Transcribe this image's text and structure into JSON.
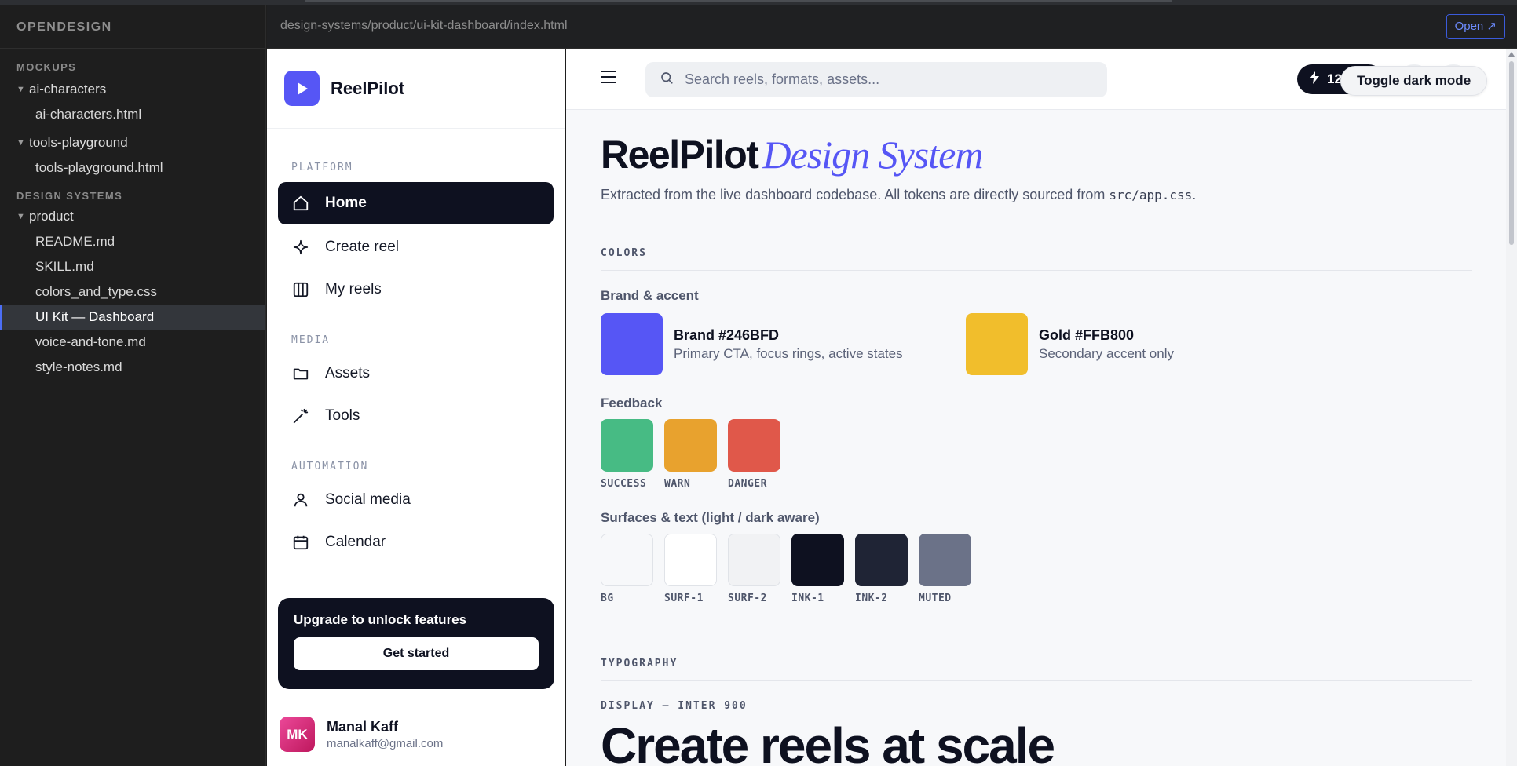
{
  "file_tree": {
    "brand": "OPENDESIGN",
    "sections": [
      {
        "title": "MOCKUPS",
        "folders": [
          {
            "name": "ai-characters",
            "files": [
              "ai-characters.html"
            ]
          },
          {
            "name": "tools-playground",
            "files": [
              "tools-playground.html"
            ]
          }
        ]
      },
      {
        "title": "DESIGN SYSTEMS",
        "folders": [
          {
            "name": "product",
            "files": [
              "README.md",
              "SKILL.md",
              "colors_and_type.css",
              "UI Kit — Dashboard",
              "voice-and-tone.md",
              "style-notes.md"
            ]
          }
        ]
      }
    ],
    "active_file": "UI Kit — Dashboard"
  },
  "address_bar": {
    "path": "design-systems/product/ui-kit-dashboard/index.html",
    "open_label": "Open ↗"
  },
  "app_sidebar": {
    "app_name": "ReelPilot",
    "sections": [
      {
        "title": "PLATFORM",
        "items": [
          {
            "label": "Home",
            "icon": "home-icon",
            "active": true
          },
          {
            "label": "Create reel",
            "icon": "sparkle-icon"
          },
          {
            "label": "My reels",
            "icon": "columns-icon"
          }
        ]
      },
      {
        "title": "MEDIA",
        "items": [
          {
            "label": "Assets",
            "icon": "folder-icon"
          },
          {
            "label": "Tools",
            "icon": "magic-wand-icon"
          }
        ]
      },
      {
        "title": "AUTOMATION",
        "items": [
          {
            "label": "Social media",
            "icon": "user-icon"
          },
          {
            "label": "Calendar",
            "icon": "calendar-icon"
          }
        ]
      }
    ],
    "upgrade": {
      "title": "Upgrade to unlock features",
      "button": "Get started"
    },
    "user": {
      "initials": "MK",
      "name": "Manal Kaff",
      "email": "manalkaff@gmail.com"
    }
  },
  "topbar": {
    "search_placeholder": "Search reels, formats, assets...",
    "credits": "12",
    "toggle_label": "Toggle dark mode"
  },
  "page": {
    "title_bold": "ReelPilot",
    "title_italic": "Design System",
    "subtitle_pre": "Extracted from the live dashboard codebase. All tokens are directly sourced from ",
    "subtitle_code": "src/app.css",
    "subtitle_post": "."
  },
  "colors": {
    "heading": "COLORS",
    "brand_group": "Brand & accent",
    "brand": [
      {
        "name": "Brand #246BFD",
        "desc": "Primary CTA, focus rings, active states",
        "hex": "#5656f5"
      },
      {
        "name": "Gold #FFB800",
        "desc": "Secondary accent only",
        "hex": "#f1be2c"
      }
    ],
    "feedback_group": "Feedback",
    "feedback": [
      {
        "label": "SUCCESS",
        "hex": "#47bb84"
      },
      {
        "label": "WARN",
        "hex": "#e8a22e"
      },
      {
        "label": "DANGER",
        "hex": "#e0584a"
      }
    ],
    "surfaces_group": "Surfaces & text (light / dark aware)",
    "surfaces": [
      {
        "label": "BG",
        "hex": "#f7f8fa"
      },
      {
        "label": "SURF-1",
        "hex": "#ffffff"
      },
      {
        "label": "SURF-2",
        "hex": "#f1f2f4"
      },
      {
        "label": "INK-1",
        "hex": "#0e1120"
      },
      {
        "label": "INK-2",
        "hex": "#1f2435"
      },
      {
        "label": "MUTED",
        "hex": "#6b7288"
      }
    ]
  },
  "typography": {
    "heading": "TYPOGRAPHY",
    "display_caption": "DISPLAY — INTER 900",
    "display_sample": "Create reels at scale"
  }
}
